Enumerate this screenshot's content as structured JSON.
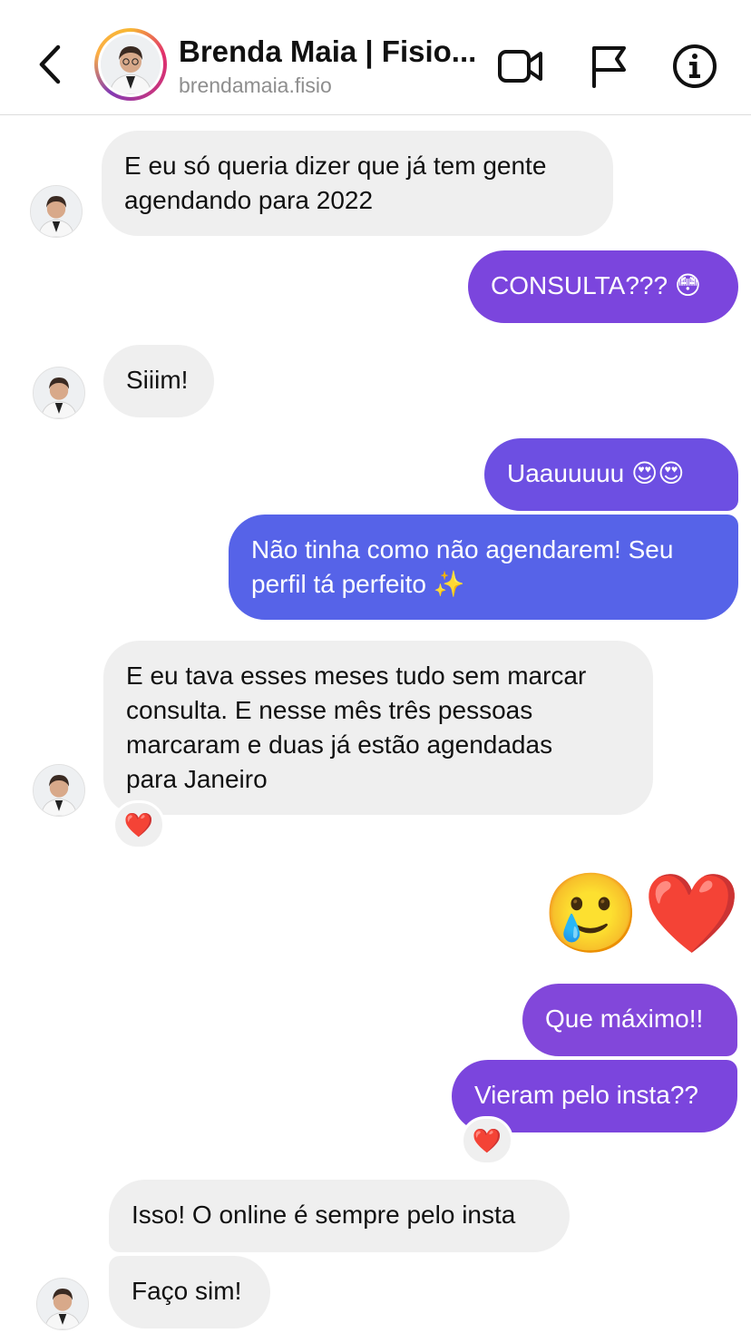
{
  "header": {
    "name": "Brenda Maia | Fisio...",
    "username": "brendamaia.fisio",
    "icons": [
      "back-arrow-icon",
      "video-call-icon",
      "flag-icon",
      "info-icon"
    ]
  },
  "messages": [
    {
      "from": "them",
      "text": "E eu só queria dizer que já tem gente\nagendando para 2022"
    },
    {
      "from": "me",
      "text": "CONSULTA??? 😳"
    },
    {
      "from": "them",
      "text": "Siiim!"
    },
    {
      "from": "me",
      "text": "Uaauuuuu 😍😍"
    },
    {
      "from": "me",
      "text": "Não tinha como não agendarem! Seu\nperfil tá perfeito ✨"
    },
    {
      "from": "them",
      "text": "E eu tava esses meses tudo sem marcar\nconsulta. E nesse mês três pessoas\nmarcaram e duas já estão agendadas\npara Janeiro",
      "reaction": "❤️"
    },
    {
      "from": "me",
      "emojis": "🥲❤️"
    },
    {
      "from": "me",
      "text": "Que máximo!!"
    },
    {
      "from": "me",
      "text": "Vieram pelo insta??",
      "reaction": "❤️"
    },
    {
      "from": "them",
      "text": "Isso! O online é sempre pelo insta"
    },
    {
      "from": "them",
      "text": "Faço sim!"
    }
  ],
  "colors": {
    "incoming_bg": "#efefef",
    "outgoing_purple": "#7b47dc",
    "outgoing_blue": "#5a5fe6"
  }
}
